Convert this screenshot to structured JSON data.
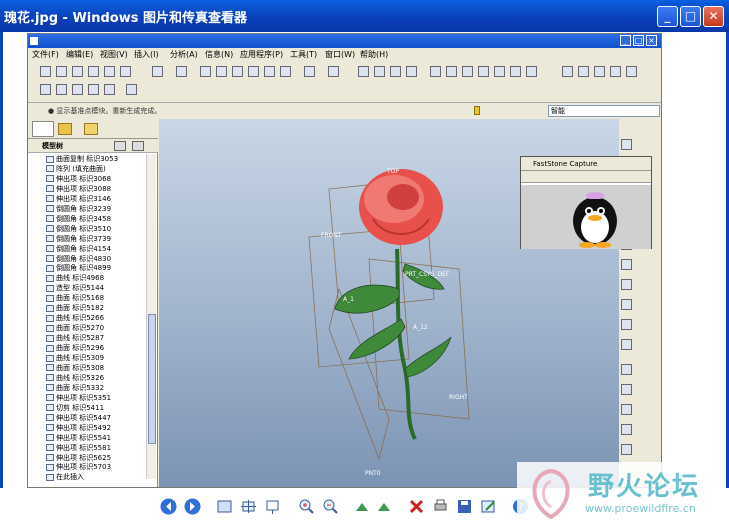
{
  "window": {
    "title": "瑰花.jpg - Windows 图片和传真查看器",
    "minimize": "_",
    "maximize": "□",
    "close": "✕"
  },
  "app": {
    "menu": [
      "文件(F)",
      "编辑(E)",
      "视图(V)",
      "插入(I)",
      "分析(A)",
      "信息(N)",
      "应用程序(P)",
      "工具(T)",
      "窗口(W)",
      "帮助(H)"
    ],
    "status_message": "● 显示基准点模块。重新生成完成。",
    "filter_value": "智能",
    "tree_title": "模型树",
    "tree_items": [
      "曲面复制 标识3053",
      "阵列 (填充曲面)",
      "伸出项 标识3068",
      "伸出项 标识3088",
      "伸出项 标识3146",
      "倒圆角 标识3239",
      "倒圆角 标识3458",
      "倒圆角 标识3510",
      "倒圆角 标识3739",
      "倒圆角 标识4154",
      "倒圆角 标识4830",
      "倒圆角 标识4899",
      "曲线 标识4968",
      "造型 标识5144",
      "曲面 标识5168",
      "曲面 标识5182",
      "曲线 标识5266",
      "曲面 标识5270",
      "曲线 标识5287",
      "曲面 标识5296",
      "曲线 标识5309",
      "曲面 标识5308",
      "曲线 标识5326",
      "曲面 标识5332",
      "伸出项 标识5351",
      "切剪 标识5411",
      "伸出项 标识5447",
      "伸出项 标识5492",
      "伸出项 标识5541",
      "伸出项 标识5581",
      "伸出项 标识5625",
      "伸出项 标识5703",
      "在此插入"
    ],
    "datum_labels": [
      "FRONT",
      "TOP",
      "RIGHT",
      "A_1",
      "A_12",
      "PRT_CSYS_DEF",
      "PNT0"
    ]
  },
  "capture": {
    "title": "FastStone Capture"
  },
  "watermark": {
    "brand": "野火论坛",
    "url": "www.proewildfire.cn"
  },
  "colors": {
    "title_blue": "#0a4ad0",
    "rose": "#e8504c",
    "leaf": "#3f8a3a"
  }
}
